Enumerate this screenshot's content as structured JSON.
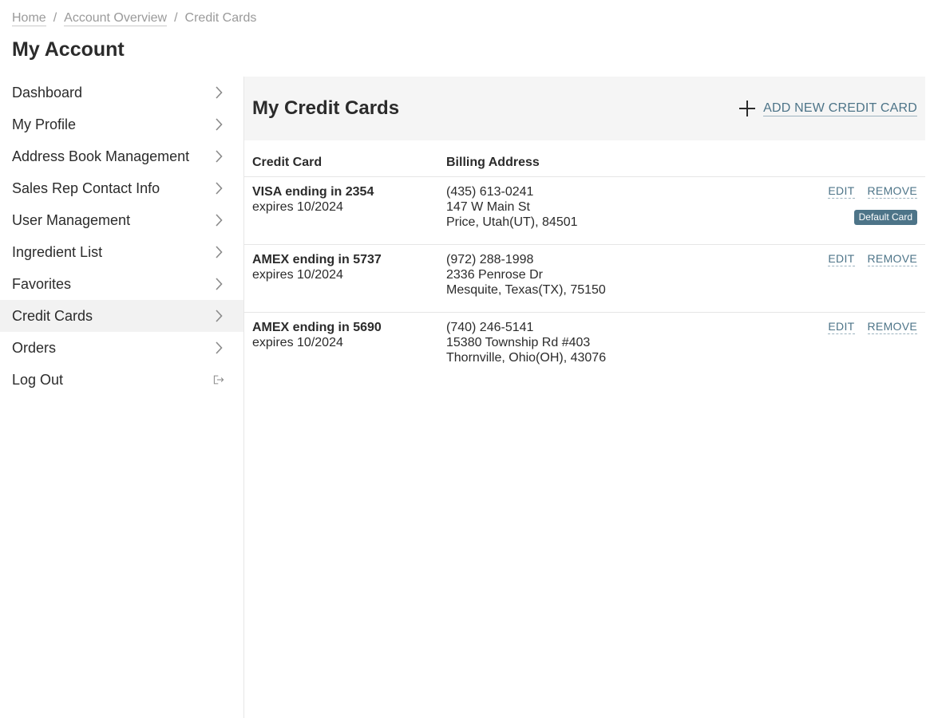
{
  "breadcrumb": {
    "home": "Home",
    "overview": "Account Overview",
    "current": "Credit Cards",
    "separator": "/"
  },
  "page_title": "My Account",
  "sidebar": {
    "items": [
      {
        "label": "Dashboard",
        "icon": "chevron-right-icon"
      },
      {
        "label": "My Profile",
        "icon": "chevron-right-icon"
      },
      {
        "label": "Address Book Management",
        "icon": "chevron-right-icon"
      },
      {
        "label": "Sales Rep Contact Info",
        "icon": "chevron-right-icon"
      },
      {
        "label": "User Management",
        "icon": "chevron-right-icon"
      },
      {
        "label": "Ingredient List",
        "icon": "chevron-right-icon"
      },
      {
        "label": "Favorites",
        "icon": "chevron-right-icon"
      },
      {
        "label": "Credit Cards",
        "icon": "chevron-right-icon",
        "active": true
      },
      {
        "label": "Orders",
        "icon": "chevron-right-icon"
      },
      {
        "label": "Log Out",
        "icon": "logout-icon"
      }
    ]
  },
  "main": {
    "title": "My Credit Cards",
    "add_button": "ADD NEW CREDIT CARD",
    "columns": {
      "card": "Credit Card",
      "address": "Billing Address"
    },
    "cards": [
      {
        "name": "VISA ending in 2354",
        "expires": "expires 10/2024",
        "phone": "(435) 613-0241",
        "street": "147 W Main St",
        "city": "Price, Utah(UT), 84501",
        "edit": "EDIT",
        "remove": "REMOVE",
        "badge": "Default Card"
      },
      {
        "name": "AMEX ending in 5737",
        "expires": "expires 10/2024",
        "phone": "(972) 288-1998",
        "street": "2336 Penrose Dr",
        "city": "Mesquite, Texas(TX), 75150",
        "edit": "EDIT",
        "remove": "REMOVE"
      },
      {
        "name": "AMEX ending in 5690",
        "expires": "expires 10/2024",
        "phone": "(740) 246-5141",
        "street": "15380 Township Rd #403",
        "city": "Thornville, Ohio(OH), 43076",
        "edit": "EDIT",
        "remove": "REMOVE"
      }
    ]
  },
  "colors": {
    "accent": "#4d7488",
    "text": "#2b2b2b",
    "muted": "#9a9a9a",
    "header_bg": "#f5f5f5",
    "active_bg": "#f2f2f2"
  }
}
